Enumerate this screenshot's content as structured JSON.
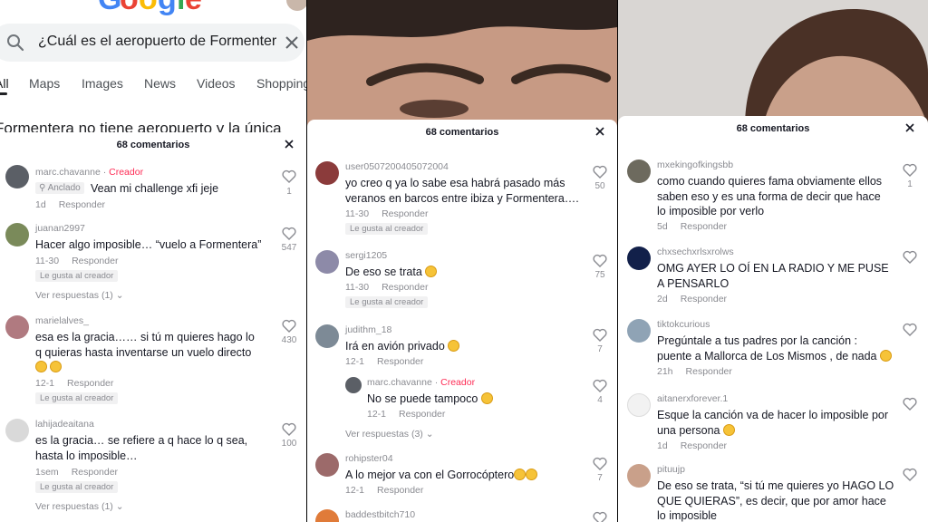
{
  "google": {
    "logo_text": "Google",
    "query": "¿Cuál es el aeropuerto de Formenter",
    "tabs": [
      "All",
      "Maps",
      "Images",
      "News",
      "Videos",
      "Shopping"
    ],
    "result_snippet": "Formentera no tiene aeropuerto y la única"
  },
  "panels": [
    {
      "title": "68 comentarios",
      "comments": [
        {
          "user": "marc.chavanne",
          "creator_label": "Creador",
          "pinned_label": "Anclado",
          "text": "Vean mi challenge xfi jeje",
          "date": "1d",
          "reply": "Responder",
          "likes": "1"
        },
        {
          "user": "juanan2997",
          "text": "Hacer algo imposible… “vuelo a Formentera”",
          "date": "11-30",
          "reply": "Responder",
          "liked_by_creator": "Le gusta al creador",
          "view_replies": "Ver respuestas (1)",
          "likes": "547"
        },
        {
          "user": "marielalves_",
          "text": "esa es la gracia…… si tú m quieres hago lo q quieras hasta inventarse un vuelo directo",
          "date": "12-1",
          "reply": "Responder",
          "liked_by_creator": "Le gusta al creador",
          "likes": "430"
        },
        {
          "user": "lahijadeaitana",
          "text": "es la gracia… se refiere a q hace lo q sea, hasta lo imposible…",
          "date": "1sem",
          "reply": "Responder",
          "liked_by_creator": "Le gusta al creador",
          "view_replies": "Ver respuestas (1)",
          "likes": "100"
        }
      ]
    },
    {
      "title": "68 comentarios",
      "comments": [
        {
          "user": "user0507200405072004",
          "text": "yo creo q ya lo sabe esa habrá pasado más veranos en barcos entre ibiza y Formentera….",
          "date": "11-30",
          "reply": "Responder",
          "liked_by_creator": "Le gusta al creador",
          "likes": "50"
        },
        {
          "user": "sergi1205",
          "text": "De eso se trata",
          "date": "11-30",
          "reply": "Responder",
          "liked_by_creator": "Le gusta al creador",
          "likes": "75"
        },
        {
          "user": "judithm_18",
          "text": "Irá en avión privado",
          "date": "12-1",
          "reply": "Responder",
          "likes": "7"
        },
        {
          "user": "marc.chavanne",
          "creator_label": "Creador",
          "text": "No se puede tampoco",
          "date": "12-1",
          "reply": "Responder",
          "likes": "4",
          "view_replies": "Ver respuestas (3)"
        },
        {
          "user": "rohipster04",
          "text": "A lo mejor va con el Gorrocóptero",
          "date": "12-1",
          "reply": "Responder",
          "likes": "7"
        },
        {
          "user": "baddestbitch710"
        }
      ]
    },
    {
      "title": "68 comentarios",
      "comments": [
        {
          "user": "mxekingofkingsbb",
          "text": "como cuando quieres fama obviamente ellos saben eso y es una forma de decir que hace lo imposible por verlo",
          "date": "5d",
          "reply": "Responder",
          "likes": "1"
        },
        {
          "user": "chxsechxrlsxrolws",
          "text": "OMG AYER LO OÍ EN LA RADIO Y ME PUSE A PENSARLO",
          "date": "2d",
          "reply": "Responder"
        },
        {
          "user": "tiktokcurious",
          "text": "Pregúntale a tus padres por la canción : puente a Mallorca de Los Mismos , de nada",
          "date": "21h",
          "reply": "Responder"
        },
        {
          "user": "aitanerxforever.1",
          "text": "Esque la canción va de hacer lo imposible por una persona",
          "date": "1d",
          "reply": "Responder"
        },
        {
          "user": "pituujp",
          "text": "De eso se trata, “si tú me quieres yo HAGO LO QUE QUIERAS”, es decir, que por amor hace lo imposible"
        }
      ]
    }
  ],
  "colors": {
    "creator": "#fe2c55",
    "muted": "#8a8b91",
    "text": "#161823"
  },
  "icons": [
    "search-icon",
    "clear-icon",
    "close-icon",
    "heart-icon",
    "pin-icon",
    "chevron-down-icon",
    "emoji-icon"
  ]
}
